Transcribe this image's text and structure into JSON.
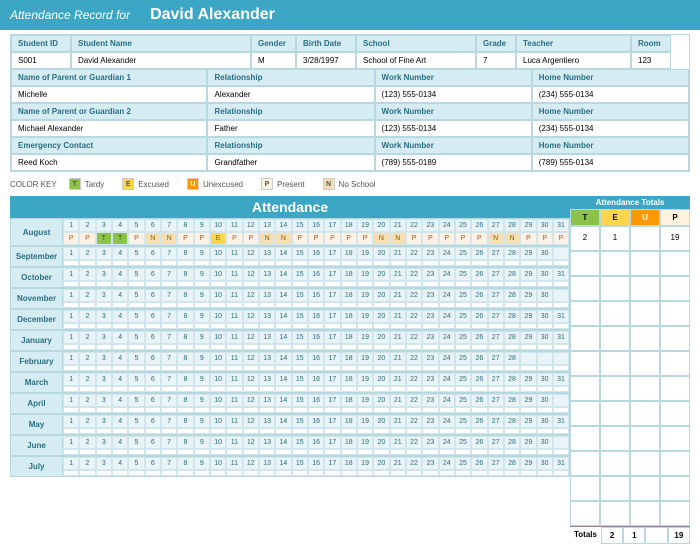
{
  "header": {
    "title": "Attendance Record for",
    "name": "David Alexander"
  },
  "student_headers": [
    "Student ID",
    "Student Name",
    "Gender",
    "Birth Date",
    "School",
    "Grade",
    "Teacher",
    "Room"
  ],
  "student_values": [
    "S001",
    "David Alexander",
    "M",
    "3/28/1997",
    "School of Fine Art",
    "7",
    "Luca Argentiero",
    "123"
  ],
  "info_rows": [
    {
      "labels": [
        "Name of Parent or Guardian 1",
        "Relationship",
        "Work Number",
        "Home Number"
      ],
      "values": [
        "Michelle",
        "Alexander",
        "(123) 555-0134",
        "(234) 555-0134"
      ]
    },
    {
      "labels": [
        "Name of Parent or Guardian 2",
        "Relationship",
        "Work Number",
        "Home Number"
      ],
      "values": [
        "Michael Alexander",
        "Father",
        "(123) 555-0134",
        "(234) 555-0134"
      ]
    },
    {
      "labels": [
        "Emergency Contact",
        "Relationship",
        "Work Number",
        "Home Number"
      ],
      "values": [
        "Reed Koch",
        "Grandfather",
        "(789) 555-0189",
        "(789) 555-0134"
      ]
    }
  ],
  "color_key": {
    "label": "COLOR KEY",
    "items": [
      {
        "code": "T",
        "name": "Tardy",
        "class": "sw-t"
      },
      {
        "code": "E",
        "name": "Excused",
        "class": "sw-e"
      },
      {
        "code": "U",
        "name": "Unexcused",
        "class": "sw-u"
      },
      {
        "code": "P",
        "name": "Present",
        "class": "sw-p"
      },
      {
        "code": "N",
        "name": "No School",
        "class": "sw-n"
      }
    ]
  },
  "attendance_title": "Attendance",
  "months": [
    {
      "name": "August",
      "days": 31,
      "start": 1,
      "codes": [
        "P",
        "P",
        "T",
        "T",
        "P",
        "N",
        "N",
        "P",
        "P",
        "E",
        "P",
        "P",
        "N",
        "N",
        "P",
        "P",
        "P",
        "P",
        "P",
        "N",
        "N",
        "P",
        "P",
        "P",
        "P",
        "P",
        "N",
        "N",
        "P",
        "P",
        "P"
      ]
    },
    {
      "name": "September",
      "days": 30,
      "start": 1,
      "codes": []
    },
    {
      "name": "October",
      "days": 31,
      "start": 1,
      "codes": []
    },
    {
      "name": "November",
      "days": 30,
      "start": 1,
      "codes": []
    },
    {
      "name": "December",
      "days": 31,
      "start": 1,
      "codes": []
    },
    {
      "name": "January",
      "days": 31,
      "start": 1,
      "codes": []
    },
    {
      "name": "February",
      "days": 28,
      "start": 1,
      "codes": []
    },
    {
      "name": "March",
      "days": 31,
      "start": 1,
      "codes": []
    },
    {
      "name": "April",
      "days": 30,
      "start": 1,
      "codes": []
    },
    {
      "name": "May",
      "days": 31,
      "start": 1,
      "codes": []
    },
    {
      "name": "June",
      "days": 30,
      "start": 1,
      "codes": []
    },
    {
      "name": "July",
      "days": 31,
      "start": 1,
      "codes": []
    }
  ],
  "totals": {
    "title": "Attendance Totals",
    "headers": [
      "T",
      "E",
      "U",
      "P"
    ],
    "rows": [
      [
        "2",
        "1",
        "",
        "19"
      ],
      [
        "",
        "",
        "",
        ""
      ],
      [
        "",
        "",
        "",
        ""
      ],
      [
        "",
        "",
        "",
        ""
      ],
      [
        "",
        "",
        "",
        ""
      ],
      [
        "",
        "",
        "",
        ""
      ],
      [
        "",
        "",
        "",
        ""
      ],
      [
        "",
        "",
        "",
        ""
      ],
      [
        "",
        "",
        "",
        ""
      ],
      [
        "",
        "",
        "",
        ""
      ],
      [
        "",
        "",
        "",
        ""
      ],
      [
        "",
        "",
        "",
        ""
      ]
    ],
    "final_label": "Totals",
    "final": [
      "2",
      "1",
      "",
      "19"
    ]
  },
  "info_widths": [
    "200px",
    "170px",
    "160px",
    "160px"
  ],
  "student_widths": [
    "60px",
    "180px",
    "45px",
    "60px",
    "120px",
    "40px",
    "115px",
    "40px"
  ]
}
